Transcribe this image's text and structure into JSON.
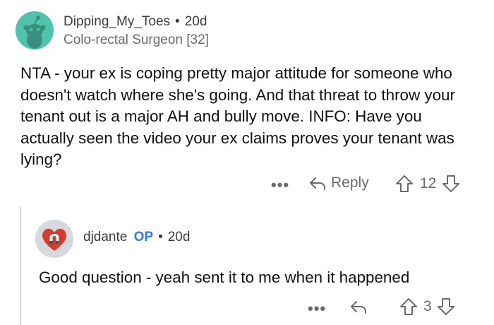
{
  "comment1": {
    "username": "Dipping_My_Toes",
    "separator": "•",
    "age": "20d",
    "flair": "Colo-rectal Surgeon [32]",
    "body": "NTA - your ex is coping pretty major attitude for someone who doesn't watch where she's going.  And that threat to throw your tenant out is a major AH and bully move.  INFO: Have you actually seen the video your ex claims proves your tenant was lying?",
    "more_label": "•••",
    "reply_label": "Reply",
    "score": "12"
  },
  "comment2": {
    "username": "djdante",
    "op_badge": "OP",
    "separator": "•",
    "age": "20d",
    "body": "Good question - yeah sent it to me when it happened",
    "more_label": "•••",
    "score": "3"
  },
  "icons": {
    "avatar1": "reddit-snoo-avatar",
    "avatar2": "heart-magnet-avatar",
    "reply": "reply-arrow-icon",
    "upvote": "upvote-arrow-icon",
    "downvote": "downvote-arrow-icon"
  },
  "colors": {
    "avatar1_bg": "#4fc3ab",
    "op_badge": "#2f7de1",
    "heart": "#d93a2b"
  }
}
